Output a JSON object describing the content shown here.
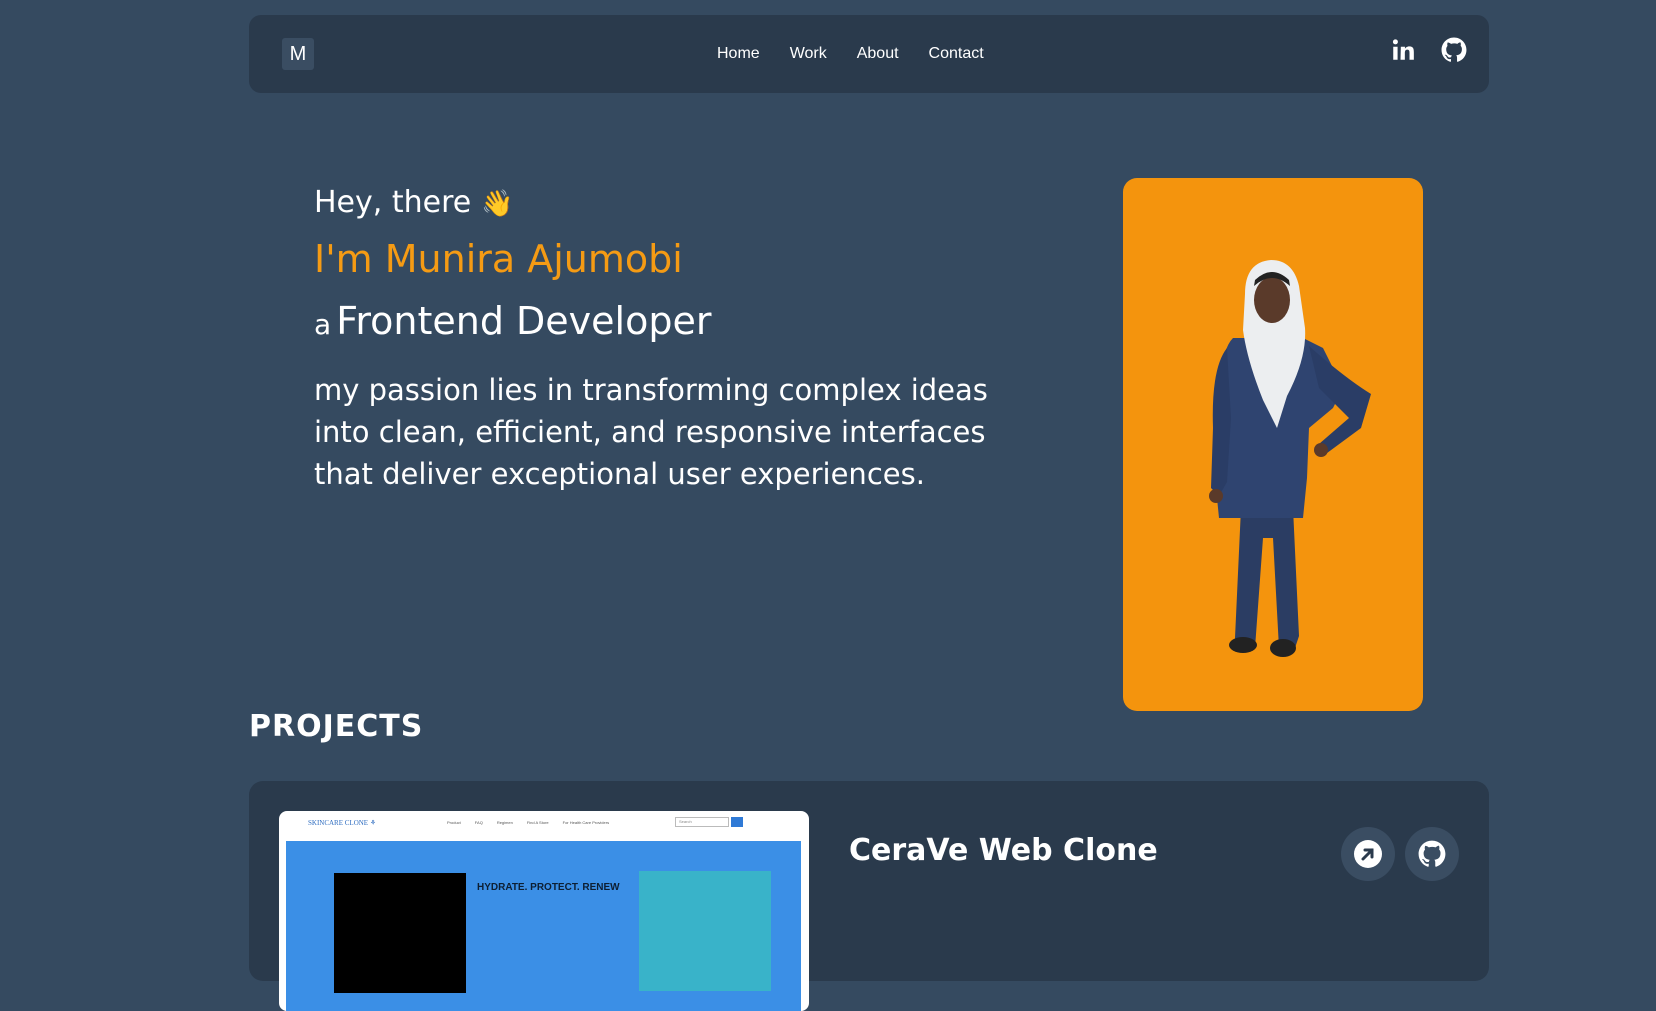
{
  "nav": {
    "logo": "M",
    "links": [
      "Home",
      "Work",
      "About",
      "Contact"
    ],
    "social": {
      "linkedin_icon": "linkedin-icon",
      "github_icon": "github-icon"
    }
  },
  "hero": {
    "greeting": "Hey, there",
    "wave": "👋",
    "name": "I'm Munira Ajumobi",
    "role_prefix": "a",
    "role": "Frontend Developer",
    "passion": "my passion lies in transforming complex ideas into clean, efficient, and responsive interfaces that deliver exceptional user experiences."
  },
  "projects": {
    "heading": "PROJECTS",
    "items": [
      {
        "title": "CeraVe Web Clone",
        "thumb": {
          "brand": "SKINCARE CLONE ⚘",
          "menu": [
            "Product",
            "FAQ",
            "Regimen",
            "Find A Store",
            "For Health Care Providers"
          ],
          "search_placeholder": "Search",
          "tagline": "HYDRATE. PROTECT. RENEW"
        }
      }
    ]
  },
  "colors": {
    "background": "#354a60",
    "panel": "#2a3a4c",
    "accent": "#f59b14",
    "photo_bg": "#f4940d"
  }
}
